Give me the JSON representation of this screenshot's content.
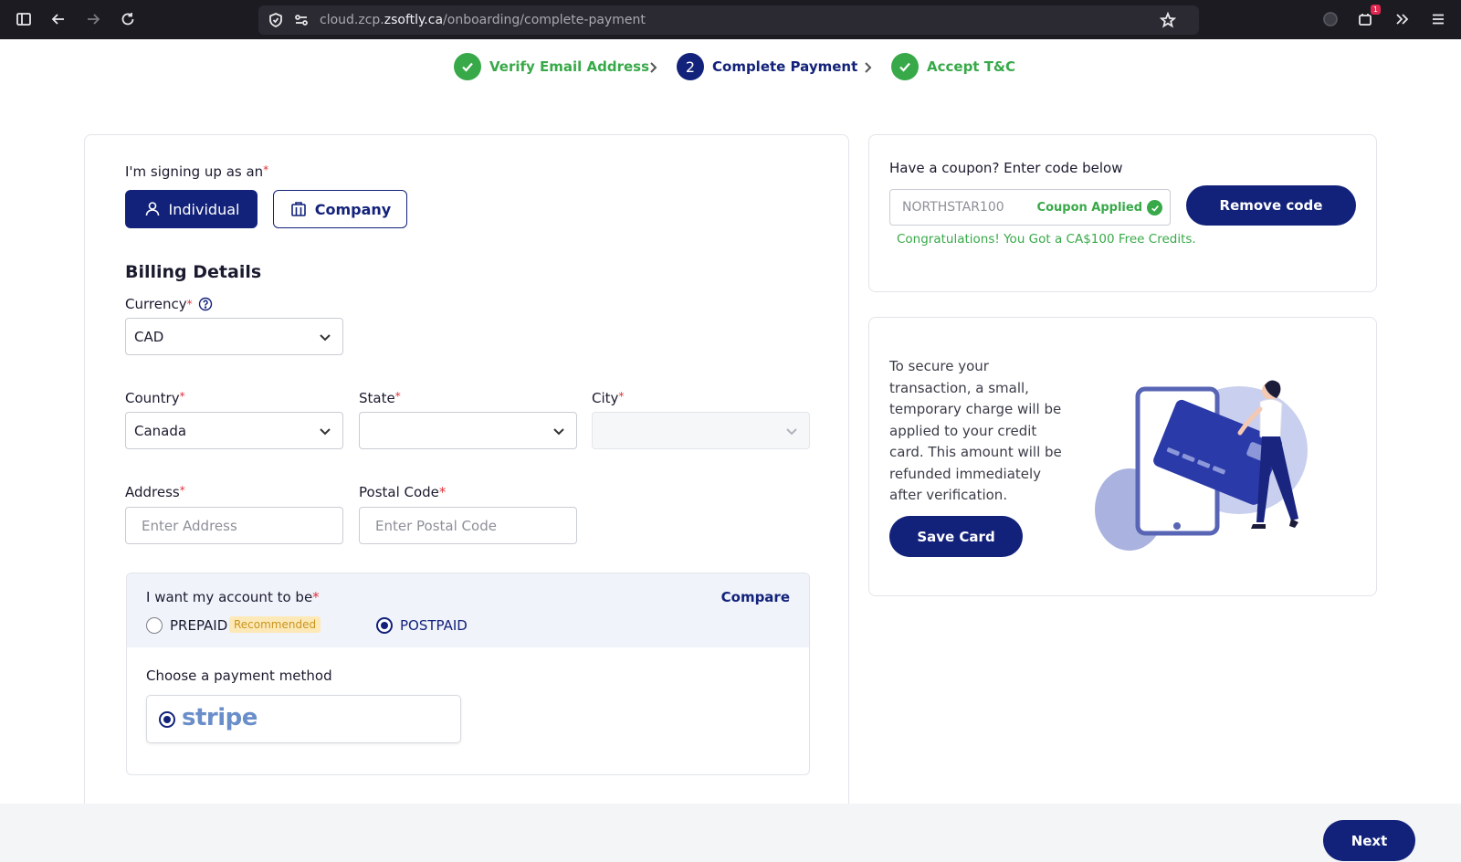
{
  "browser": {
    "url_prefix": "cloud.zcp.",
    "url_domain": "zsoftly.ca",
    "url_path": "/onboarding/complete-payment",
    "ext_badge": "1"
  },
  "stepper": {
    "steps": [
      {
        "label": "Verify Email Address",
        "state": "done"
      },
      {
        "number": "2",
        "label": "Complete Payment",
        "state": "active"
      },
      {
        "label": "Accept T&C",
        "state": "done"
      }
    ]
  },
  "signup": {
    "label": "I'm signing up as an",
    "required": "*",
    "individual": "Individual",
    "company": "Company"
  },
  "billing": {
    "title": "Billing Details",
    "currency_label": "Currency",
    "currency_value": "CAD",
    "country_label": "Country",
    "country_value": "Canada",
    "state_label": "State",
    "state_value": "",
    "city_label": "City",
    "city_value": "",
    "address_label": "Address",
    "address_placeholder": "Enter Address",
    "postal_label": "Postal Code",
    "postal_placeholder": "Enter Postal Code"
  },
  "account": {
    "label": "I want my account to be",
    "compare": "Compare",
    "prepaid": "PREPAID",
    "recommended": "Recommended",
    "postpaid": "POSTPAID",
    "selected": "POSTPAID",
    "payment_label": "Choose a payment method",
    "payment_option": "stripe"
  },
  "coupon": {
    "label": "Have a coupon? Enter code below",
    "code": "NORTHSTAR100",
    "status": "Coupon Applied",
    "remove_button": "Remove code",
    "message": "Congratulations! You Got a CA$100 Free Credits."
  },
  "verify": {
    "text": "To secure your transaction, a small, temporary charge will be applied to your credit card. This amount will be refunded immediately after verification.",
    "save_button": "Save Card"
  },
  "footer": {
    "next_button": "Next"
  },
  "colors": {
    "primary": "#12227a",
    "success": "#38a949",
    "required": "#e0313b"
  }
}
